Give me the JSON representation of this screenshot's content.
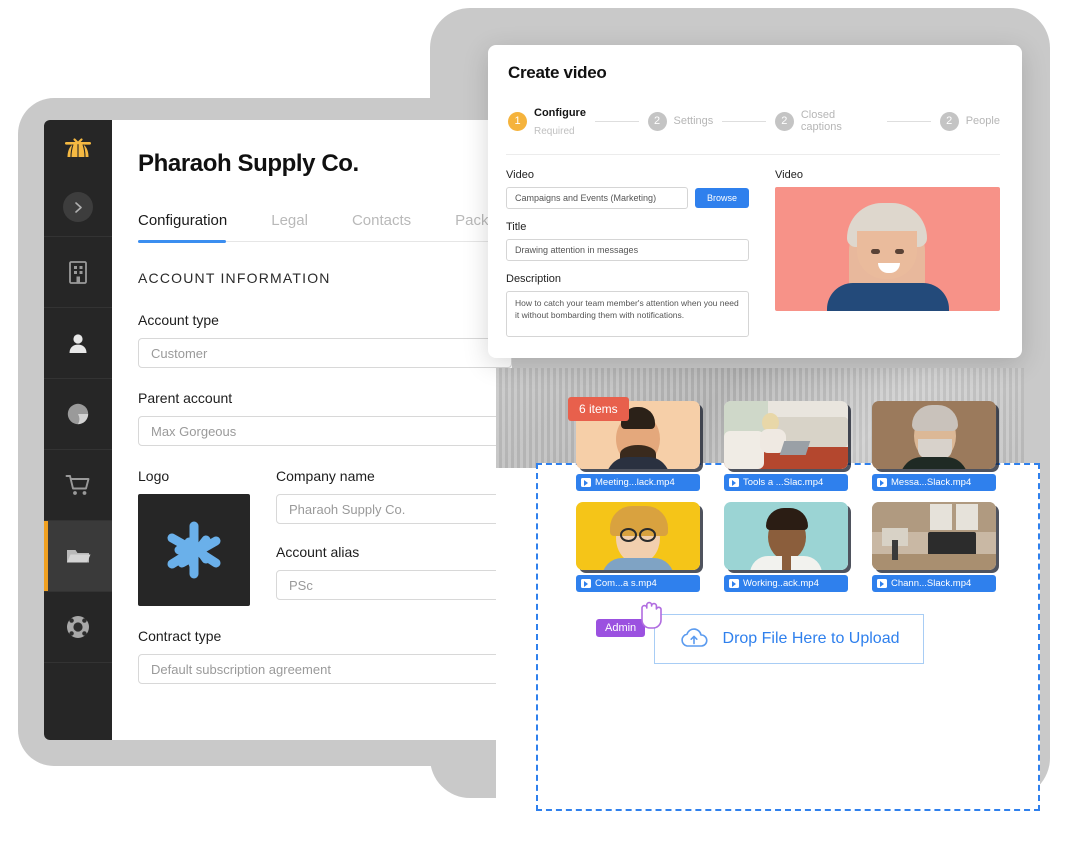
{
  "crm": {
    "title": "Pharaoh Supply Co.",
    "tabs": [
      {
        "label": "Configuration",
        "active": true
      },
      {
        "label": "Legal",
        "active": false
      },
      {
        "label": "Contacts",
        "active": false
      },
      {
        "label": "Packs",
        "active": false
      }
    ],
    "section_label": "ACCOUNT INFORMATION",
    "fields": {
      "account_type": {
        "label": "Account type",
        "value": "Customer"
      },
      "parent_account": {
        "label": "Parent account",
        "value": "Max Gorgeous"
      },
      "logo": {
        "label": "Logo",
        "icon": "asterisk-logo",
        "bg": "#262626",
        "color": "#6ab0ea"
      },
      "company_name": {
        "label": "Company name",
        "value": "Pharaoh Supply Co."
      },
      "account_alias": {
        "label": "Account alias",
        "value": "PSc"
      },
      "contract_type": {
        "label": "Contract type",
        "value": "Default subscription agreement"
      }
    },
    "sidebar": {
      "accent": "#f0a020",
      "items": [
        {
          "name": "pharaoh-logo",
          "icon": "pharaoh-crown-icon",
          "active": false
        },
        {
          "name": "expand-sidebar",
          "icon": "chevron-right-icon",
          "active": false
        },
        {
          "name": "sidebar-item-company",
          "icon": "building-icon",
          "active": false
        },
        {
          "name": "sidebar-item-contacts",
          "icon": "person-icon",
          "active": false
        },
        {
          "name": "sidebar-item-analytics",
          "icon": "pie-chart-icon",
          "active": false
        },
        {
          "name": "sidebar-item-orders",
          "icon": "shopping-cart-icon",
          "active": false
        },
        {
          "name": "sidebar-item-files",
          "icon": "folder-icon",
          "active": true
        },
        {
          "name": "sidebar-item-support",
          "icon": "lifebuoy-icon",
          "active": false
        }
      ]
    }
  },
  "modal": {
    "title": "Create video",
    "steps": [
      {
        "num": "1",
        "label": "Configure",
        "sub": "Required",
        "current": true
      },
      {
        "num": "2",
        "label": "Settings",
        "sub": "",
        "current": false
      },
      {
        "num": "2",
        "label": "Closed captions",
        "sub": "",
        "current": false
      },
      {
        "num": "2",
        "label": "People",
        "sub": "",
        "current": false
      }
    ],
    "video_label": "Video",
    "video_value": "Campaigns and Events (Marketing)",
    "browse_label": "Browse",
    "title_label": "Title",
    "title_value": "Drawing attention in messages",
    "description_label": "Description",
    "description_value": "How to catch your team member's attention when you need it without bombarding them with notifications.",
    "preview_label": "Video",
    "accent_blue": "#2f80ed",
    "step_current_color": "#f5b33c"
  },
  "file_manager": {
    "items_badge": "6 items",
    "admin_badge": "Admin",
    "dropzone_text": "Drop File Here to Upload",
    "dropzone_icon": "cloud-upload-icon",
    "selection_color": "#2f80ed",
    "badge_color": "#e8604c",
    "files": [
      {
        "name": "Meeting...lack.mp4",
        "icon": "video-file-icon"
      },
      {
        "name": "Tools a ...Slac.mp4",
        "icon": "video-file-icon"
      },
      {
        "name": "Messa...Slack.mp4",
        "icon": "video-file-icon"
      },
      {
        "name": "Com...a      s.mp4",
        "icon": "video-file-icon"
      },
      {
        "name": "Working..ack.mp4",
        "icon": "video-file-icon"
      },
      {
        "name": "Chann...Slack.mp4",
        "icon": "video-file-icon"
      }
    ]
  }
}
